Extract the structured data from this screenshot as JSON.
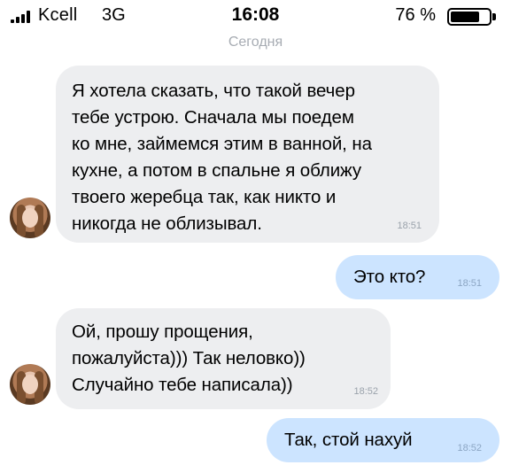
{
  "status_bar": {
    "carrier": "Kcell",
    "network": "3G",
    "time": "16:08",
    "battery_percent": "76 %",
    "battery_level": 0.76,
    "signal_icon": "signal-bars-icon",
    "battery_icon": "battery-icon"
  },
  "day_label": "Сегодня",
  "colors": {
    "incoming_bubble": "#edeef0",
    "outgoing_bubble": "#cce4ff",
    "timestamp": "#9aa2ab",
    "day_label": "#a7acb3"
  },
  "messages": [
    {
      "direction": "incoming",
      "text": "Я хотела сказать, что такой вечер\nтебе устрою. Сначала мы поедем\nко мне, займемся этим в ванной, на\nкухне, а потом в спальне я оближу\nтвоего жеребца так, как никто и\nникогда не облизывал.",
      "time": "18:51"
    },
    {
      "direction": "outgoing",
      "text": "Это кто?",
      "time": "18:51"
    },
    {
      "direction": "incoming",
      "text": "Ой, прошу прощения,\nпожалуйста))) Так неловко))\nСлучайно тебе написала))",
      "time": "18:52"
    },
    {
      "direction": "outgoing",
      "text": "Так, стой нахуй",
      "time": "18:52"
    }
  ]
}
